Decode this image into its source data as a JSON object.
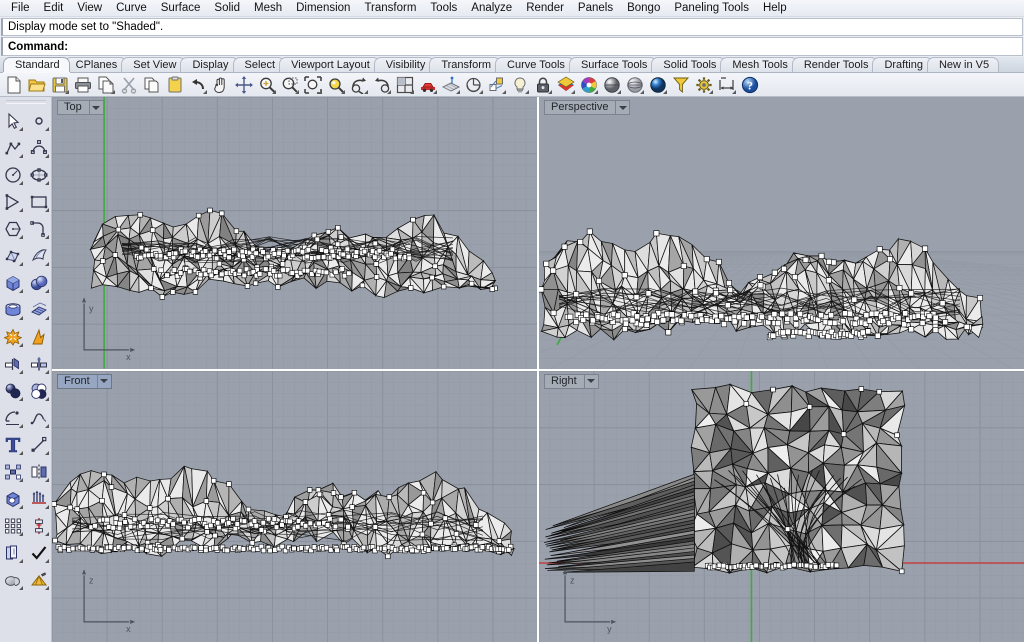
{
  "menubar": {
    "items": [
      {
        "label": "File"
      },
      {
        "label": "Edit"
      },
      {
        "label": "View"
      },
      {
        "label": "Curve"
      },
      {
        "label": "Surface"
      },
      {
        "label": "Solid"
      },
      {
        "label": "Mesh"
      },
      {
        "label": "Dimension"
      },
      {
        "label": "Transform"
      },
      {
        "label": "Tools"
      },
      {
        "label": "Analyze"
      },
      {
        "label": "Render"
      },
      {
        "label": "Panels"
      },
      {
        "label": "Bongo"
      },
      {
        "label": "Paneling Tools"
      },
      {
        "label": "Help"
      }
    ]
  },
  "command": {
    "history_line": "Display mode set to \"Shaded\".",
    "prompt_label": "Command:",
    "input_value": "",
    "input_placeholder": ""
  },
  "toolbar_tabs": {
    "active": "Standard",
    "items": [
      {
        "label": "Standard"
      },
      {
        "label": "CPlanes"
      },
      {
        "label": "Set View"
      },
      {
        "label": "Display"
      },
      {
        "label": "Select"
      },
      {
        "label": "Viewport Layout"
      },
      {
        "label": "Visibility"
      },
      {
        "label": "Transform"
      },
      {
        "label": "Curve Tools"
      },
      {
        "label": "Surface Tools"
      },
      {
        "label": "Solid Tools"
      },
      {
        "label": "Mesh Tools"
      },
      {
        "label": "Render Tools"
      },
      {
        "label": "Drafting"
      },
      {
        "label": "New in V5"
      }
    ]
  },
  "icon_toolbar": {
    "buttons": [
      {
        "icon": "new-file-icon",
        "title": "New",
        "flyout": false
      },
      {
        "icon": "open-folder-icon",
        "title": "Open",
        "flyout": false
      },
      {
        "icon": "save-disk-icon",
        "title": "Save",
        "flyout": true
      },
      {
        "icon": "print-icon",
        "title": "Print",
        "flyout": false
      },
      {
        "icon": "copy-page-icon",
        "title": "Copy to clipboard",
        "flyout": true
      },
      {
        "icon": "scissors-cut-icon",
        "title": "Cut",
        "flyout": false
      },
      {
        "icon": "copy-icon",
        "title": "Copy",
        "flyout": false
      },
      {
        "icon": "paste-clipboard-icon",
        "title": "Paste",
        "flyout": false
      },
      {
        "icon": "undo-arrow-icon",
        "title": "Undo",
        "flyout": true
      },
      {
        "icon": "pan-hand-icon",
        "title": "Pan",
        "flyout": false
      },
      {
        "icon": "move-arrows-icon",
        "title": "Move",
        "flyout": false
      },
      {
        "icon": "zoom-in-magnifier-icon",
        "title": "Zoom In",
        "flyout": true
      },
      {
        "icon": "zoom-window-icon",
        "title": "Zoom Window",
        "flyout": true
      },
      {
        "icon": "zoom-extents-icon",
        "title": "Zoom Extents",
        "flyout": true
      },
      {
        "icon": "zoom-selected-icon",
        "title": "Zoom Selected",
        "flyout": true
      },
      {
        "icon": "rotate-view-icon",
        "title": "Rotate View",
        "flyout": true
      },
      {
        "icon": "undo-view-icon",
        "title": "Undo View Change",
        "flyout": true
      },
      {
        "icon": "four-viewport-icon",
        "title": "4 Viewports",
        "flyout": true
      },
      {
        "icon": "car-render-icon",
        "title": "Render",
        "flyout": true
      },
      {
        "icon": "cplane-icon",
        "title": "Set CPlane",
        "flyout": true
      },
      {
        "icon": "named-view-icon",
        "title": "Named Views",
        "flyout": true
      },
      {
        "icon": "object-properties-icon",
        "title": "Properties",
        "flyout": true
      },
      {
        "icon": "light-bulb-icon",
        "title": "Lights",
        "flyout": true
      },
      {
        "icon": "lock-icon",
        "title": "Lock Object",
        "flyout": true
      },
      {
        "icon": "layers-icon",
        "title": "Layers",
        "flyout": true
      },
      {
        "icon": "color-wheel-icon",
        "title": "Object Color",
        "flyout": true
      },
      {
        "icon": "shaded-sphere-icon",
        "title": "Shaded Viewport",
        "flyout": true
      },
      {
        "icon": "ghosted-sphere-icon",
        "title": "Ghosted Viewport",
        "flyout": true
      },
      {
        "icon": "rendered-sphere-icon",
        "title": "Rendered Viewport",
        "flyout": true
      },
      {
        "icon": "selection-filter-icon",
        "title": "Selection Filter",
        "flyout": false
      },
      {
        "icon": "options-gear-icon",
        "title": "Options",
        "flyout": true
      },
      {
        "icon": "distance-dimension-icon",
        "title": "Dimension",
        "flyout": true
      },
      {
        "icon": "help-question-icon",
        "title": "Help",
        "flyout": false
      }
    ]
  },
  "sidebar": {
    "rows": [
      [
        {
          "icon": "select-arrow-icon",
          "flyout": true
        },
        {
          "icon": "point-object-icon",
          "flyout": true
        }
      ],
      [
        {
          "icon": "polyline-icon",
          "flyout": true
        },
        {
          "icon": "control-point-curve-icon",
          "flyout": true
        }
      ],
      [
        {
          "icon": "circle-icon",
          "flyout": true
        },
        {
          "icon": "ellipse-icon",
          "flyout": true
        }
      ],
      [
        {
          "icon": "triangle-polygon-icon",
          "flyout": true
        },
        {
          "icon": "rectangle-icon",
          "flyout": true
        }
      ],
      [
        {
          "icon": "hexagon-polygon-icon",
          "flyout": true
        },
        {
          "icon": "fillet-curve-icon",
          "flyout": true
        }
      ],
      [
        {
          "icon": "surface-from-points-icon",
          "flyout": true
        },
        {
          "icon": "loft-surface-icon",
          "flyout": true
        }
      ],
      [
        {
          "icon": "box-solid-icon",
          "flyout": true
        },
        {
          "icon": "sphere-boolean-icon",
          "flyout": true
        }
      ],
      [
        {
          "icon": "cylinder-solid-icon",
          "flyout": true
        },
        {
          "icon": "surface-array-icon",
          "flyout": true
        }
      ],
      [
        {
          "icon": "explode-icon",
          "flyout": true
        },
        {
          "icon": "boolean-split-icon",
          "flyout": false
        }
      ],
      [
        {
          "icon": "trim-icon",
          "flyout": true
        },
        {
          "icon": "split-icon",
          "flyout": true
        }
      ],
      [
        {
          "icon": "boolean-union-icon",
          "flyout": true
        },
        {
          "icon": "boolean-difference-icon",
          "flyout": true
        }
      ],
      [
        {
          "icon": "fillet-edge-icon",
          "flyout": true
        },
        {
          "icon": "blend-curve-icon",
          "flyout": true
        }
      ],
      [
        {
          "icon": "text-object-icon",
          "flyout": true
        },
        {
          "icon": "scale-icon",
          "flyout": true
        }
      ],
      [
        {
          "icon": "array-icon",
          "flyout": true
        },
        {
          "icon": "mirror-icon",
          "flyout": true
        }
      ],
      [
        {
          "icon": "cap-planar-holes-icon",
          "flyout": true
        },
        {
          "icon": "extrude-curve-icon",
          "flyout": true
        }
      ],
      [
        {
          "icon": "rectangular-array-icon",
          "flyout": true
        },
        {
          "icon": "align-icon",
          "flyout": true
        }
      ],
      [
        {
          "icon": "offset-surface-icon",
          "flyout": true
        },
        {
          "icon": "check-mark-icon",
          "flyout": true
        }
      ],
      [
        {
          "icon": "show-objects-icon",
          "flyout": true
        },
        {
          "icon": "render-mesh-icon",
          "flyout": true
        }
      ]
    ]
  },
  "viewports": [
    {
      "name": "Top",
      "active": false,
      "axes": {
        "vertical": "y",
        "horizontal": "x"
      },
      "projection": "parallel"
    },
    {
      "name": "Perspective",
      "active": false,
      "axes": null,
      "projection": "perspective"
    },
    {
      "name": "Front",
      "active": true,
      "axes": {
        "vertical": "z",
        "horizontal": "x"
      },
      "projection": "parallel"
    },
    {
      "name": "Right",
      "active": false,
      "axes": {
        "vertical": "z",
        "horizontal": "y"
      },
      "projection": "parallel"
    }
  ],
  "colors": {
    "viewport_background": "#9aa1ac",
    "grid_minor": "#949ba6",
    "grid_major": "#8a919d",
    "axis_y_green": "#3faa3f",
    "axis_x_red": "#c44040",
    "mesh_fill_light": "#e3e3e3",
    "mesh_fill_dark": "#6e6e6e",
    "mesh_wire": "#1a1a1a",
    "control_point": "#ffffff",
    "window_chrome": "#e9ecf2",
    "toolbar_tab_active": "#f6f8fb"
  },
  "scene": {
    "description": "Triangulated terrain-like mesh with visible control points shown in four viewports",
    "display_mode": "Shaded",
    "control_points_visible": true
  }
}
